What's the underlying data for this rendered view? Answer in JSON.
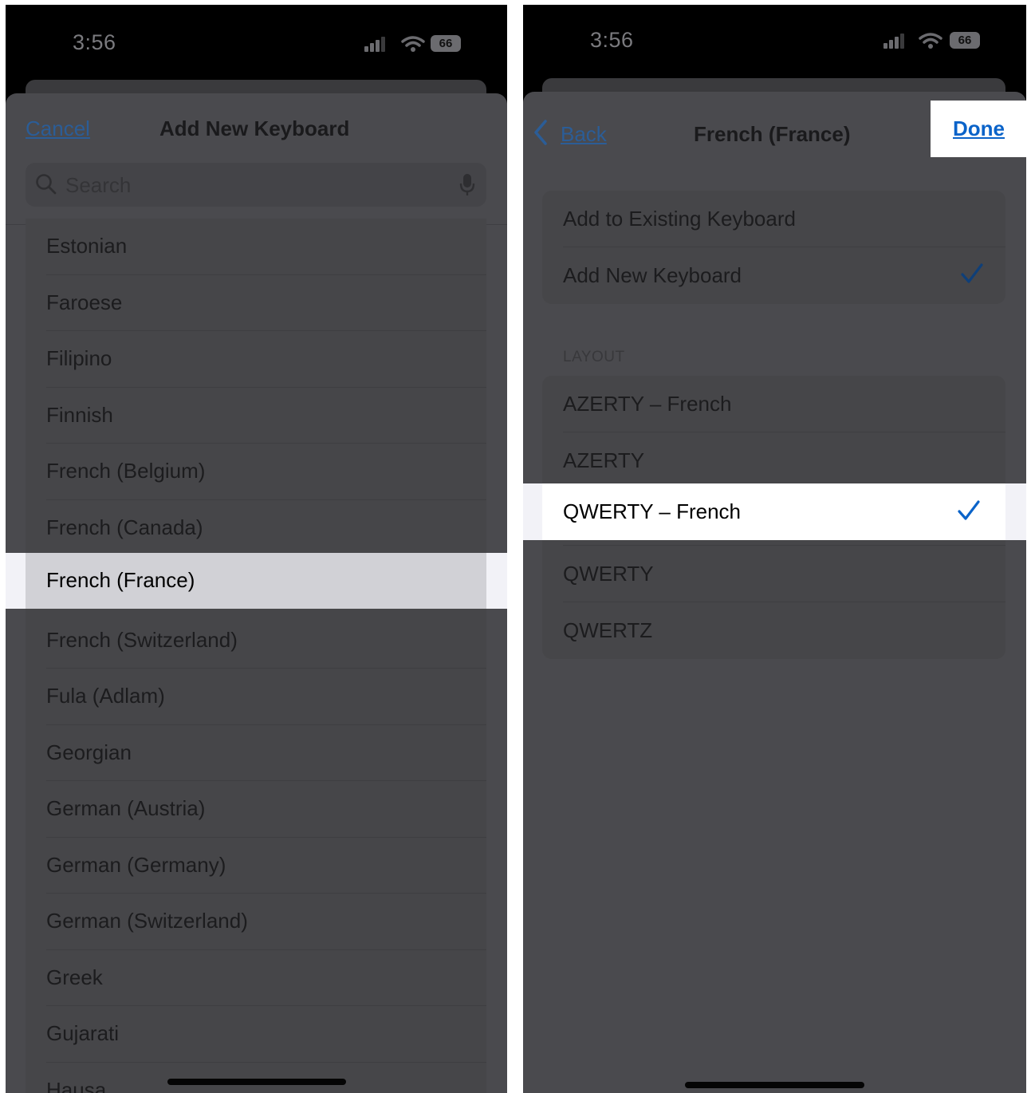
{
  "left_screen": {
    "status": {
      "time": "3:56",
      "battery": "66"
    },
    "nav": {
      "cancel_label": "Cancel",
      "title": "Add New Keyboard"
    },
    "search": {
      "placeholder": "Search"
    },
    "languages": [
      "Estonian",
      "Faroese",
      "Filipino",
      "Finnish",
      "French (Belgium)",
      "French (Canada)",
      "French (France)",
      "French (Switzerland)",
      "Fula (Adlam)",
      "Georgian",
      "German (Austria)",
      "German (Germany)",
      "German (Switzerland)",
      "Greek",
      "Gujarati",
      "Hausa"
    ],
    "selected_language": "French (France)"
  },
  "right_screen": {
    "status": {
      "time": "3:56",
      "battery": "66"
    },
    "nav": {
      "back_label": "Back",
      "title": "French (France)",
      "done_label": "Done"
    },
    "mode_options": [
      {
        "label": "Add to Existing Keyboard",
        "checked": false
      },
      {
        "label": "Add New Keyboard",
        "checked": true
      }
    ],
    "layout_header": "LAYOUT",
    "layout_options": [
      {
        "label": "AZERTY – French",
        "checked": false
      },
      {
        "label": "AZERTY",
        "checked": false
      },
      {
        "label": "QWERTY – French",
        "checked": true
      },
      {
        "label": "QWERTY",
        "checked": false
      },
      {
        "label": "QWERTZ",
        "checked": false
      }
    ]
  },
  "colors": {
    "accent": "#0a63c9",
    "highlight": "#ffffff",
    "dim_overlay_sheet": "#4a4a4e"
  }
}
